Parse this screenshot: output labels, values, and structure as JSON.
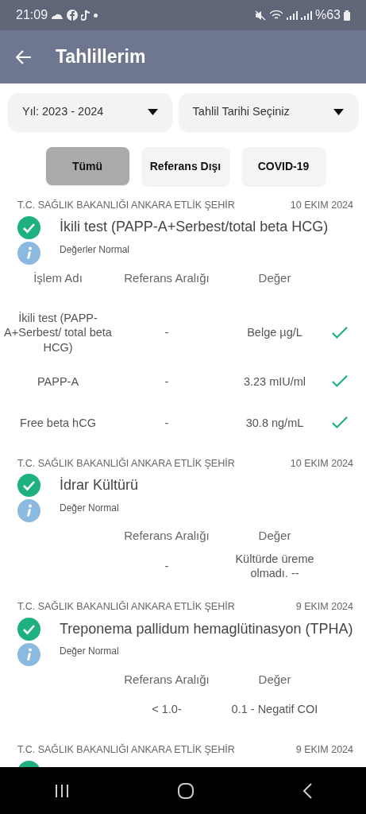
{
  "status_bar": {
    "time": "21:09",
    "battery": "%63"
  },
  "app_bar": {
    "title": "Tahlillerim"
  },
  "filters": [
    {
      "label": "Yıl: 2023 - 2024"
    },
    {
      "label": "Tahlil Tarihi Seçiniz"
    }
  ],
  "segments": [
    {
      "label": "Tümü",
      "selected": true
    },
    {
      "label": "Referans Dışı",
      "selected": false
    },
    {
      "label": "COVID-19",
      "selected": false
    }
  ],
  "tests": [
    {
      "hospital": "T.C. SAĞLIK BAKANLIĞI ANKARA ETLİK ŞEHİR",
      "date": "10 EKIM 2024",
      "title": "İkili test (PAPP-A+Serbest/total beta HCG)",
      "status": "Değerler Normal",
      "headers": {
        "name": "İşlem Adı",
        "reference": "Referans Aralığı",
        "value": "Değer"
      },
      "rows": [
        {
          "name": "İkili test (PAPP-A+Serbest/ total beta HCG)",
          "reference": "-",
          "value": "Belge µg/L",
          "checked": true
        },
        {
          "name": "PAPP-A",
          "reference": "-",
          "value": "3.23 mIU/ml",
          "checked": true
        },
        {
          "name": "Free beta hCG",
          "reference": "-",
          "value": "30.8 ng/mL",
          "checked": true
        }
      ]
    },
    {
      "hospital": "T.C. SAĞLIK BAKANLIĞI ANKARA ETLİK ŞEHİR",
      "date": "10 EKIM 2024",
      "title": "İdrar Kültürü",
      "status": "Değer Normal",
      "headers": {
        "reference": "Referans Aralığı",
        "value": "Değer"
      },
      "rows": [
        {
          "reference": "-",
          "value": "Kültürde üreme olmadı. --",
          "checked": false
        }
      ]
    },
    {
      "hospital": "T.C. SAĞLIK BAKANLIĞI ANKARA ETLİK ŞEHİR",
      "date": "9 EKIM 2024",
      "title": "Treponema pallidum hemaglütinasyon (TPHA)",
      "status": "Değer Normal",
      "headers": {
        "reference": "Referans Aralığı",
        "value": "Değer"
      },
      "rows": [
        {
          "reference": "< 1.0-",
          "value": "0.1 - Negatif COI",
          "checked": false
        }
      ]
    },
    {
      "hospital": "T.C. SAĞLIK BAKANLIĞI ANKARA ETLİK ŞEHİR",
      "date": "9 EKIM 2024"
    }
  ]
}
